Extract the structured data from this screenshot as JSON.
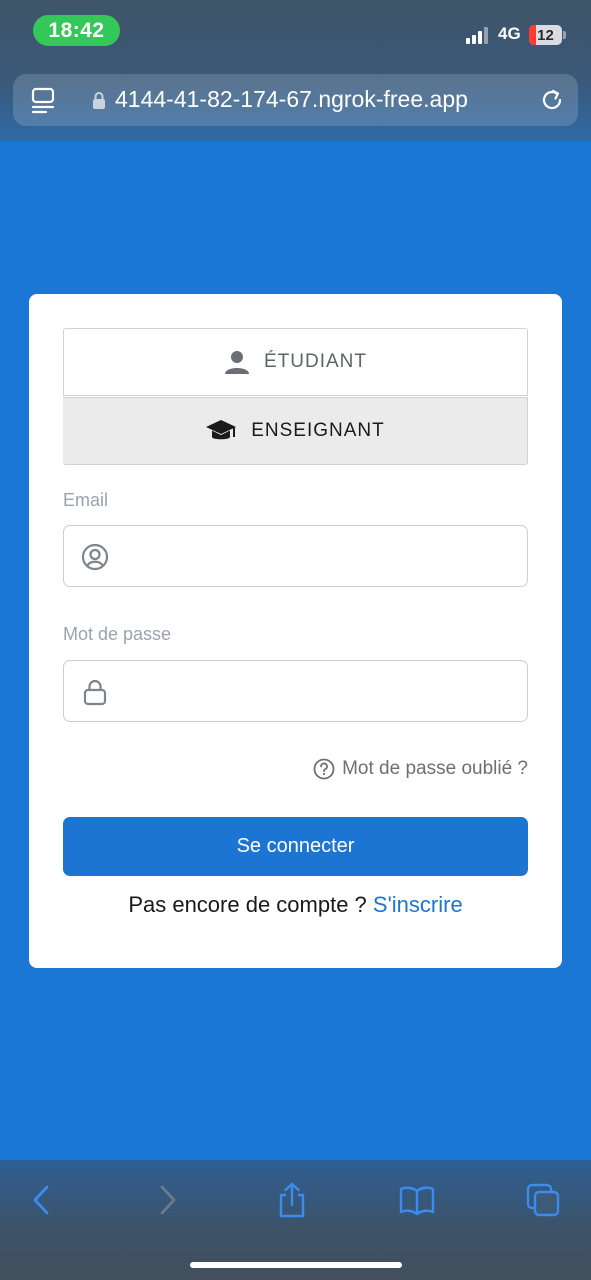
{
  "status_bar": {
    "time": "18:42",
    "network": "4G",
    "battery": "12"
  },
  "browser": {
    "url": "4144-41-82-174-67.ngrok-free.app"
  },
  "login": {
    "roles": [
      {
        "label": "ÉTUDIANT",
        "icon": "person-icon"
      },
      {
        "label": "ENSEIGNANT",
        "icon": "graduation-cap-icon",
        "selected": true
      }
    ],
    "email_label": "Email",
    "email_value": "",
    "password_label": "Mot de passe",
    "password_value": "",
    "forgot_label": "Mot de passe oublié ?",
    "submit_label": "Se connecter",
    "signup_prompt": "Pas encore de compte ? ",
    "signup_link": "S'inscrire"
  },
  "colors": {
    "background": "#1a77d6",
    "primary": "#1c75d3",
    "status_pill": "#34c759"
  }
}
